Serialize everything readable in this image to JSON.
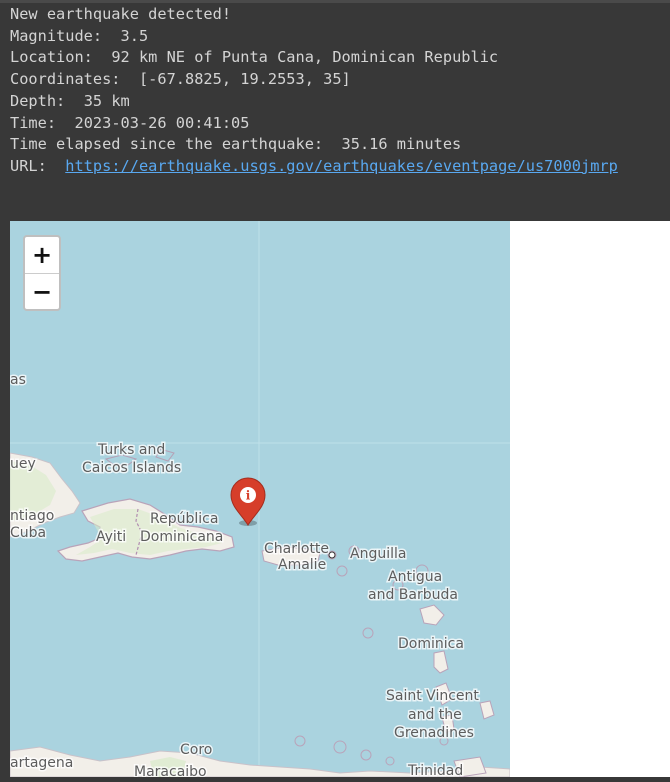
{
  "output": {
    "line1": "New earthquake detected!",
    "magnitude_label": "Magnitude:",
    "magnitude_value": "3.5",
    "location_label": "Location:",
    "location_value": "92 km NE of Punta Cana, Dominican Republic",
    "coordinates_label": "Coordinates:",
    "coordinates_value": "[-67.8825, 19.2553, 35]",
    "depth_label": "Depth:",
    "depth_value": "35 km",
    "time_label": "Time:",
    "time_value": "2023-03-26 00:41:05",
    "elapsed_label": "Time elapsed since the earthquake:",
    "elapsed_value": "35.16 minutes",
    "url_label": "URL:",
    "url_value": "https://earthquake.usgs.gov/earthquakes/eventpage/us7000jmrp"
  },
  "map": {
    "zoom_in": "+",
    "zoom_out": "−",
    "marker_icon": "info-marker-icon",
    "marker_color": "#d63e2a",
    "water_color": "#aad3df",
    "land_color": "#f2efe9",
    "labels": {
      "bahamas_partial": "as",
      "turks_line1": "Turks and",
      "turks_line2": "Caicos Islands",
      "cuba_partial": "uey",
      "santiago_partial": "ntiago",
      "cuba_partial2": "Cuba",
      "ayiti": "Ayiti",
      "republica": "República",
      "dominicana": "Dominicana",
      "charlotte": "Charlotte",
      "amalie": "Amalie",
      "anguilla": "Anguilla",
      "antigua_line1": "Antigua",
      "antigua_line2": "and Barbuda",
      "dominica": "Dominica",
      "svg_line1": "Saint Vincent",
      "svg_line2": "and the",
      "svg_line3": "Grenadines",
      "coro": "Coro",
      "cartagena_partial": "artagena",
      "maracaibo": "Maracaibo",
      "trinidad": "Trinidad"
    }
  }
}
